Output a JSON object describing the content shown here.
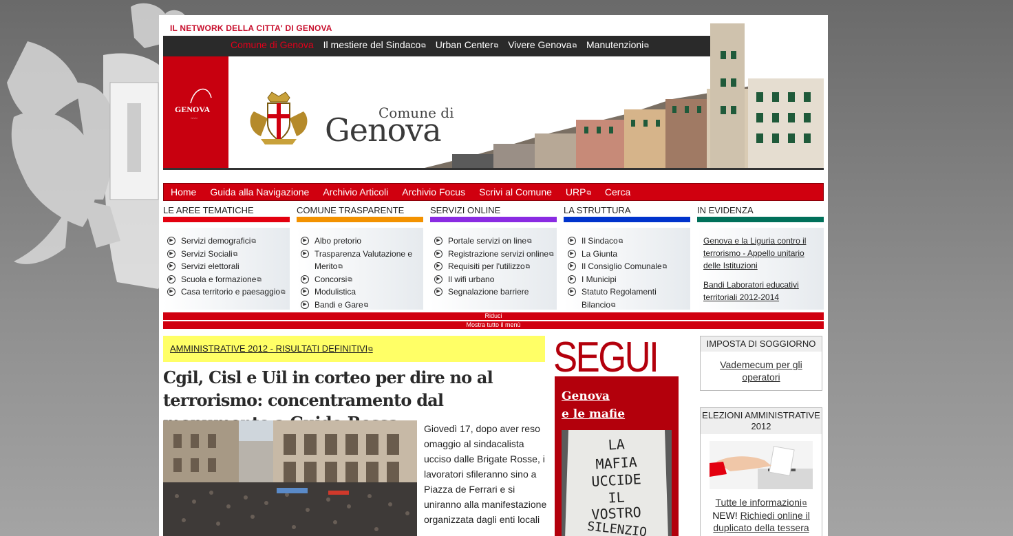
{
  "network_title": "IL NETWORK DELLA CITTA' DI GENOVA",
  "top_links": [
    {
      "label": "Comune di Genova",
      "external": false,
      "active": true
    },
    {
      "label": "Il mestiere del Sindaco",
      "external": true,
      "active": false
    },
    {
      "label": "Urban Center",
      "external": true,
      "active": false
    },
    {
      "label": "Vivere Genova",
      "external": true,
      "active": false
    },
    {
      "label": "Manutenzioni",
      "external": true,
      "active": false
    }
  ],
  "header": {
    "logo_text": "GENOVA",
    "brand_small": "Comune di",
    "brand_big": "Genova"
  },
  "main_nav": [
    "Home",
    "Guida alla Navigazione",
    "Archivio Articoli",
    "Archivio Focus",
    "Scrivi al Comune",
    "URP",
    "Cerca"
  ],
  "menu": {
    "aree": {
      "title": "LE AREE TEMATICHE",
      "color": "#e3000f",
      "items": [
        "Servizi demografici",
        "Servizi Sociali",
        "Servizi elettorali",
        "Scuola e formazione",
        "Casa territorio e paesaggio"
      ]
    },
    "trasparente": {
      "title": "COMUNE TRASPARENTE",
      "color": "#f39200",
      "items": [
        "Albo pretorio",
        "Trasparenza Valutazione e Merito",
        "Concorsi",
        "Modulistica",
        "Bandi e Gare"
      ]
    },
    "servizi": {
      "title": "SERVIZI ONLINE",
      "color": "#8a2be2",
      "items": [
        "Portale servizi on line",
        "Registrazione servizi online",
        "Requisiti per l'utilizzo",
        "Il wifi urbano",
        "Segnalazione barriere"
      ]
    },
    "struttura": {
      "title": "LA STRUTTURA",
      "color": "#0033cc",
      "items": [
        "Il Sindaco",
        "La Giunta",
        "Il Consiglio Comunale",
        "I Municipi",
        "Statuto Regolamenti Bilancio"
      ]
    },
    "evidenza": {
      "title": "IN EVIDENZA",
      "color": "#00705a",
      "items": [
        "Genova e la Liguria contro il terrorismo - Appello unitario delle Istituzioni",
        "Bandi Laboratori educativi territoriali 2012-2014"
      ]
    }
  },
  "menu_controls": {
    "collapse": "Riduci",
    "show_all": "Mostra tutto il menù"
  },
  "notice": "AMMINISTRATIVE 2012 - RISULTATI DEFINITIVI",
  "headline": "Cgil, Cisl e Uil in corteo per dire no al terrorismo: concentramento dal monumento a Guido Rossa",
  "news_text": "Giovedì 17, dopo aver reso omaggio al sindacalista ucciso dalle Brigate Rosse, i lavoratori sfileranno sino a Piazza de Ferrari e si uniranno alla manifestazione organizzata dagli enti locali",
  "segui": {
    "title": "SEGUI",
    "link_line1": "Genova",
    "link_line2": "e le mafie",
    "sign_text": "LA MAFIA UCCIDE IL VOSTRO SILENZIO PURE"
  },
  "sidebar": {
    "soggiorno": {
      "title": "IMPOSTA DI SOGGIORNO",
      "link": "Vademecum per gli operatori"
    },
    "elezioni": {
      "title": "ELEZIONI AMMINISTRATIVE 2012",
      "link_info": "Tutte le informazioni",
      "new_label": "NEW!",
      "link_tessera": "Richiedi online il duplicato della tessera elettorale"
    }
  }
}
